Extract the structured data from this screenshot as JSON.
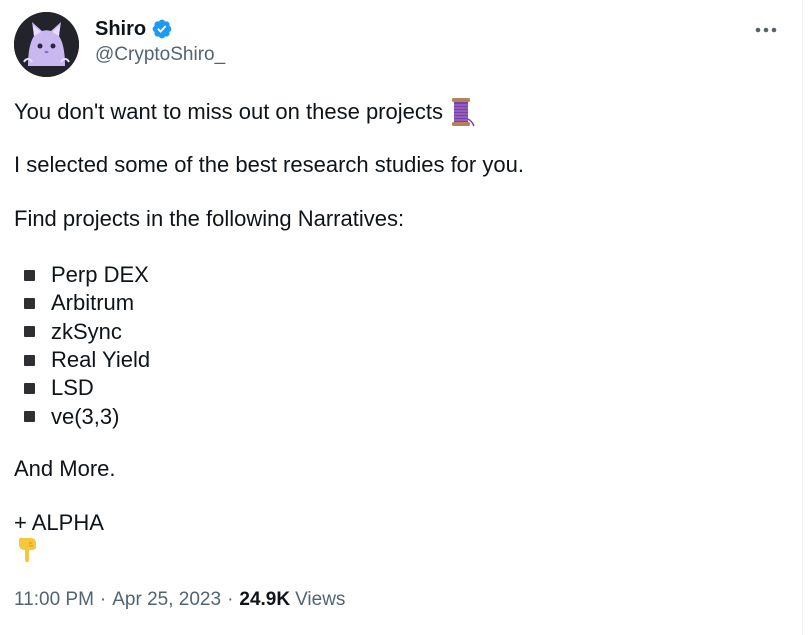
{
  "author": {
    "display_name": "Shiro",
    "handle": "@CryptoShiro_",
    "verified_icon": "verified-badge-icon",
    "avatar_icon": "cat-avatar"
  },
  "more_icon": "more-horizontal-icon",
  "tweet": {
    "line1": "You don't want to miss out on these projects",
    "line1_emoji": "thread-spool-emoji",
    "line2": "I selected some of the best research studies for you.",
    "line3": "Find projects in the following Narratives:",
    "narratives": [
      "Perp DEX",
      "Arbitrum",
      "zkSync",
      "Real Yield",
      "LSD",
      "ve(3,3)"
    ],
    "line4": "And More.",
    "line5": "+ ALPHA",
    "line6_emoji": "backhand-index-pointing-down-emoji"
  },
  "meta": {
    "time": "11:00 PM",
    "separator": "·",
    "date": "Apr 25, 2023",
    "views_count": "24.9K",
    "views_label": "Views"
  },
  "colors": {
    "text_primary": "#0f1419",
    "text_secondary": "#536471",
    "verified_blue": "#1d9bf0"
  }
}
